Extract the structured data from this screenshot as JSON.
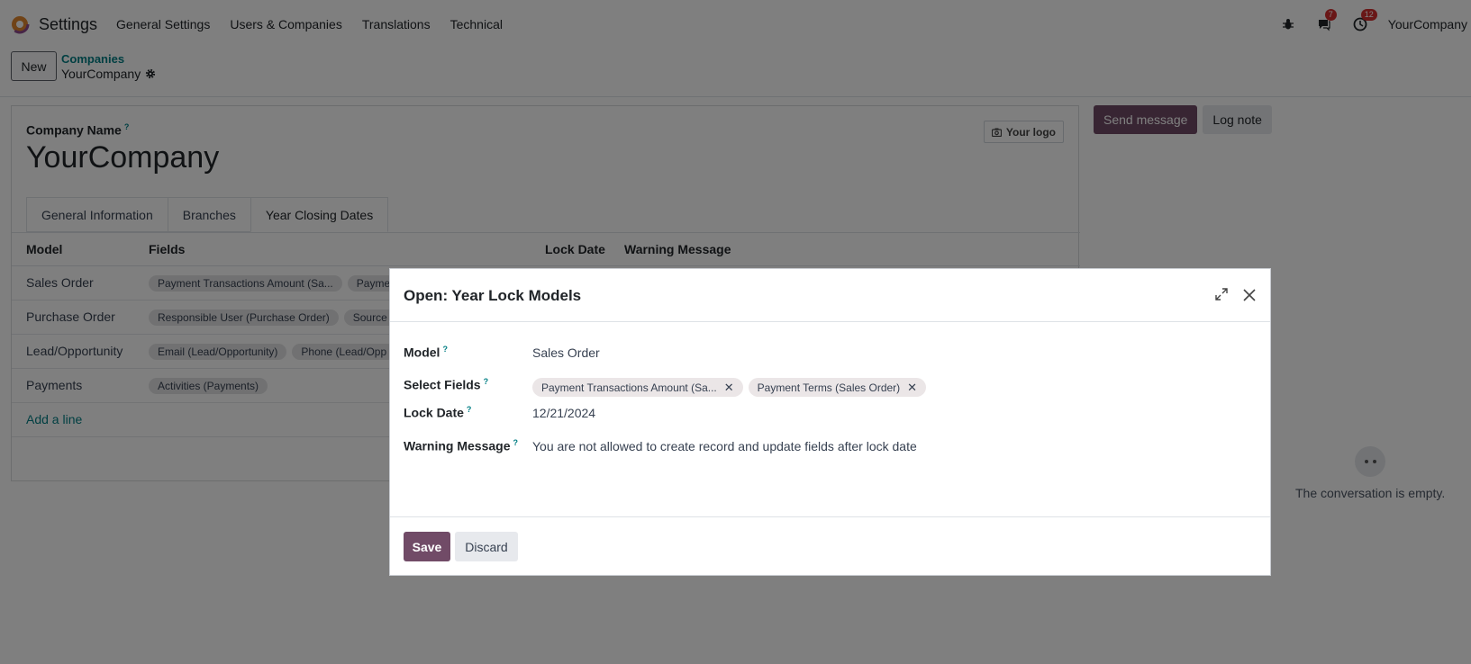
{
  "navbar": {
    "app_name": "Settings",
    "menu": [
      "General Settings",
      "Users & Companies",
      "Translations",
      "Technical"
    ],
    "messages_count": "7",
    "activities_count": "12",
    "company": "YourCompany"
  },
  "control": {
    "new_label": "New",
    "breadcrumb_parent": "Companies",
    "breadcrumb_current": "YourCompany"
  },
  "form": {
    "company_name_label": "Company Name",
    "help_mark": "?",
    "company_name": "YourCompany",
    "logo_label": "Your logo",
    "tabs": [
      "General Information",
      "Branches",
      "Year Closing Dates"
    ],
    "table": {
      "headers": {
        "model": "Model",
        "fields": "Fields",
        "lock_date": "Lock Date",
        "warning": "Warning Message"
      },
      "rows": [
        {
          "model": "Sales Order",
          "tags": [
            "Payment Transactions Amount (Sa...",
            "Payme"
          ]
        },
        {
          "model": "Purchase Order",
          "tags": [
            "Responsible User (Purchase Order)",
            "Source"
          ]
        },
        {
          "model": "Lead/Opportunity",
          "tags": [
            "Email (Lead/Opportunity)",
            "Phone (Lead/Opp"
          ]
        },
        {
          "model": "Payments",
          "tags": [
            "Activities (Payments)"
          ]
        }
      ],
      "add_line": "Add a line"
    }
  },
  "chatter": {
    "send_message": "Send message",
    "log_note": "Log note",
    "empty_text": "The conversation is empty."
  },
  "dialog": {
    "title": "Open: Year Lock Models",
    "model_label": "Model",
    "model_value": "Sales Order",
    "select_fields_label": "Select Fields",
    "select_fields": [
      "Payment Transactions Amount (Sa...",
      "Payment Terms (Sales Order)"
    ],
    "lock_date_label": "Lock Date",
    "lock_date_value": "12/21/2024",
    "warning_label": "Warning Message",
    "warning_value": "You are not allowed to create record and update fields after lock date",
    "save_label": "Save",
    "discard_label": "Discard"
  },
  "colors": {
    "brand": "#714b67",
    "link": "#017e84",
    "badge": "#d32f2f"
  },
  "icons": [
    "odoo-logo-icon",
    "bug-icon",
    "chat-icon",
    "clock-icon",
    "gear-icon",
    "camera-icon",
    "expand-icon",
    "close-icon",
    "remove-tag-icon",
    "empty-face-icon"
  ]
}
